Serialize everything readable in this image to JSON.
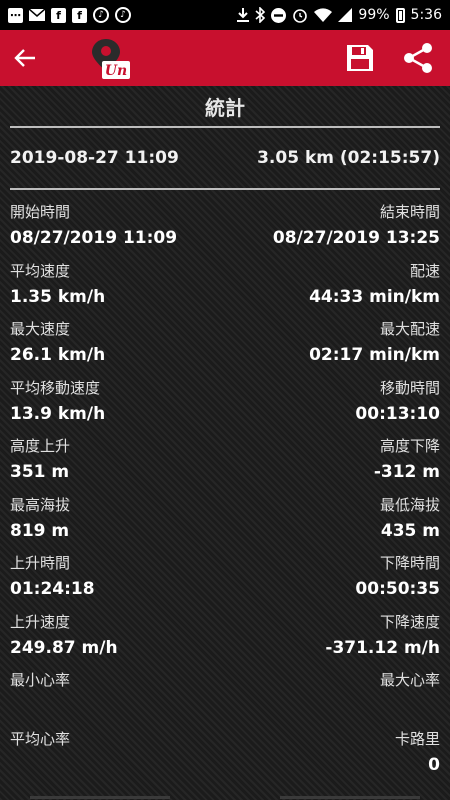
{
  "status_bar": {
    "battery": "99%",
    "time": "5:36",
    "icons": [
      "more-icon",
      "mail-icon",
      "facebook-icon",
      "facebook-icon",
      "music-note-icon",
      "music-note-icon",
      "download-icon",
      "bluetooth-icon",
      "dnd-icon",
      "alarm-icon",
      "wifi-icon",
      "signal-icon",
      "battery-icon"
    ]
  },
  "app_bar": {
    "color": "#c8102e",
    "logo_text": "Un"
  },
  "section_title": "統計",
  "summary": {
    "datetime": "2019-08-27 11:09",
    "distance": "3.05 km (02:15:57)"
  },
  "stats": [
    {
      "left_label": "開始時間",
      "left_value": "08/27/2019 11:09",
      "right_label": "結束時間",
      "right_value": "08/27/2019 13:25"
    },
    {
      "left_label": "平均速度",
      "left_value": "1.35 km/h",
      "right_label": "配速",
      "right_value": "44:33 min/km"
    },
    {
      "left_label": "最大速度",
      "left_value": "26.1 km/h",
      "right_label": "最大配速",
      "right_value": "02:17 min/km"
    },
    {
      "left_label": "平均移動速度",
      "left_value": "13.9 km/h",
      "right_label": "移動時間",
      "right_value": "00:13:10"
    },
    {
      "left_label": "高度上升",
      "left_value": "351 m",
      "right_label": "高度下降",
      "right_value": "-312 m"
    },
    {
      "left_label": "最高海拔",
      "left_value": "819 m",
      "right_label": "最低海拔",
      "right_value": "435 m"
    },
    {
      "left_label": "上升時間",
      "left_value": "01:24:18",
      "right_label": "下降時間",
      "right_value": "00:50:35"
    },
    {
      "left_label": "上升速度",
      "left_value": "249.87 m/h",
      "right_label": "下降速度",
      "right_value": "-371.12 m/h"
    },
    {
      "left_label": "最小心率",
      "left_value": "",
      "right_label": "最大心率",
      "right_value": ""
    },
    {
      "left_label": "平均心率",
      "left_value": "",
      "right_label": "卡路里",
      "right_value": "0"
    }
  ]
}
